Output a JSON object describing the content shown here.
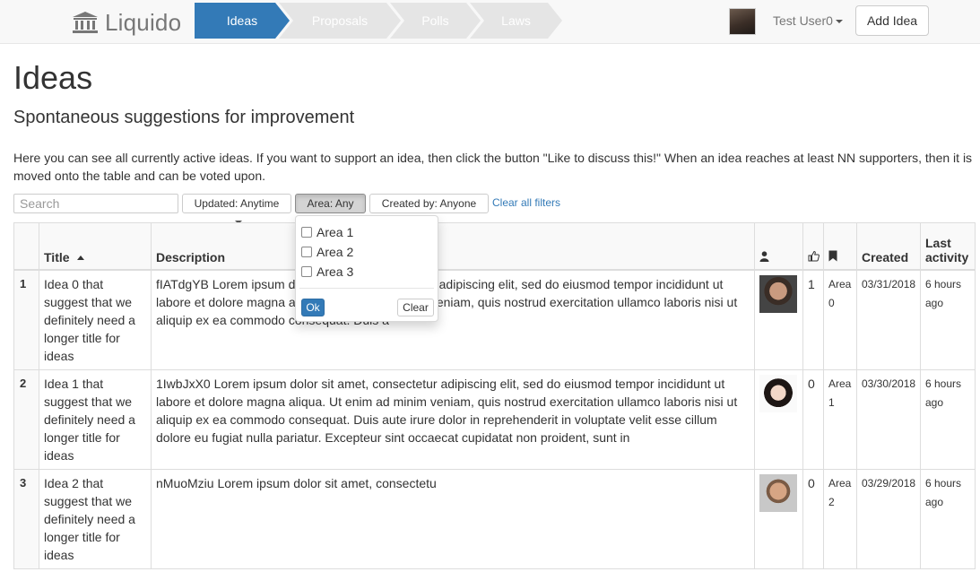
{
  "app": {
    "brand": "Liquido"
  },
  "nav": {
    "tabs": [
      {
        "label": "Ideas",
        "active": true
      },
      {
        "label": "Proposals",
        "active": false
      },
      {
        "label": "Polls",
        "active": false
      },
      {
        "label": "Laws",
        "active": false
      }
    ],
    "user_name": "Test User0",
    "add_idea_label": "Add Idea"
  },
  "page": {
    "title": "Ideas",
    "subtitle": "Spontaneous suggestions for improvement",
    "intro": "Here you can see all currently active ideas. If you want to support an idea, then click the button \"Like to discuss this!\" When an idea reaches at least NN supporters, then it is moved onto the table and can be voted upon."
  },
  "filters": {
    "search_placeholder": "Search",
    "updated_label": "Updated: Anytime",
    "area_label": "Area: Any",
    "created_by_label": "Created by: Anyone",
    "clear_all_label": "Clear all filters"
  },
  "area_dropdown": {
    "options": [
      "Area 1",
      "Area 2",
      "Area 3"
    ],
    "ok_label": "Ok",
    "clear_label": "Clear"
  },
  "table": {
    "headers": {
      "title": "Title",
      "description": "Description",
      "created": "Created",
      "last_activity": "Last activity"
    },
    "rows": [
      {
        "num": "1",
        "title": "Idea 0 that suggest that we definitely need a longer title for ideas",
        "description": "fIATdgYB Lorem ipsum dolor sit amet, consectetur adipiscing elit, sed do eiusmod tempor incididunt ut labore et dolore magna aliqua. Ut enim ad minim veniam, quis nostrud exercitation ullamco laboris nisi ut aliquip ex ea commodo consequat. Duis a",
        "likes": "1",
        "area": "Area 0",
        "created": "03/31/2018",
        "last_activity": "6 hours ago"
      },
      {
        "num": "2",
        "title": "Idea 1 that suggest that we definitely need a longer title for ideas",
        "description": "1IwbJxX0 Lorem ipsum dolor sit amet, consectetur adipiscing elit, sed do eiusmod tempor incididunt ut labore et dolore magna aliqua. Ut enim ad minim veniam, quis nostrud exercitation ullamco laboris nisi ut aliquip ex ea commodo consequat. Duis aute irure dolor in reprehenderit in voluptate velit esse cillum dolore eu fugiat nulla pariatur. Excepteur sint occaecat cupidatat non proident, sunt in",
        "likes": "0",
        "area": "Area 1",
        "created": "03/30/2018",
        "last_activity": "6 hours ago"
      },
      {
        "num": "3",
        "title": "Idea 2 that suggest that we definitely need a longer title for ideas",
        "description": "nMuoMziu Lorem ipsum dolor sit amet, consectetu",
        "likes": "0",
        "area": "Area 2",
        "created": "03/29/2018",
        "last_activity": "6 hours ago"
      }
    ]
  },
  "colors": {
    "primary": "#337ab7",
    "nav_bg": "#f8f8f8",
    "inactive_crumb": "#e5e5e5"
  }
}
